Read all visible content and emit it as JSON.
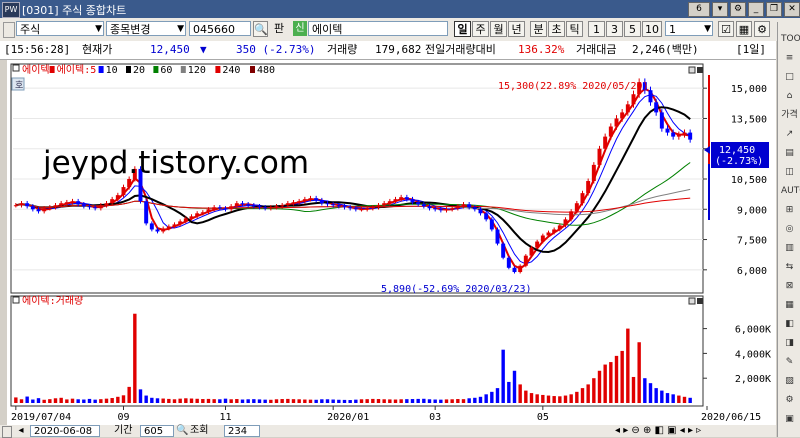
{
  "window": {
    "title": "[0301] 주식 종합차트",
    "logo": "PW",
    "page_num": "6"
  },
  "toolbar": {
    "market": "주식",
    "change_btn": "종목변경",
    "code": "045660",
    "pan_label": "판",
    "sin_label": "신",
    "name": "에이텍",
    "periods": [
      "일",
      "주",
      "월",
      "년",
      "분",
      "초",
      "틱"
    ],
    "intervals": [
      "1",
      "3",
      "5",
      "10"
    ],
    "interval_value": "1"
  },
  "infobar": {
    "time": "[15:56:28]",
    "price_label": "현재가",
    "price": "12,450",
    "arrow": "▼",
    "change": "350 (-2.73%)",
    "volume_label": "거래량",
    "volume": "179,682",
    "prev_ratio_label": "전일거래량대비",
    "prev_ratio": "136.32%",
    "amount_label": "거래대금",
    "amount": "2,246(백만)",
    "period_tag": "[1일]"
  },
  "price_legend": {
    "items": [
      {
        "label": "에이텍",
        "color": "#e00000"
      },
      {
        "label": "에이텍:5",
        "color": "#e00000"
      },
      {
        "label": "10",
        "color": "#0000ff"
      },
      {
        "label": "20",
        "color": "#000000"
      },
      {
        "label": "60",
        "color": "#008000"
      },
      {
        "label": "120",
        "color": "#808080"
      },
      {
        "label": "240",
        "color": "#e00000"
      },
      {
        "label": "480",
        "color": "#800000"
      }
    ]
  },
  "volume_legend": {
    "label": "에이텍:거래량"
  },
  "watermark": "jeypd.tistory.com",
  "annotations": {
    "high": "15,300(22.89% 2020/05/20)",
    "low": "5,890(-52.69% 2020/03/23)",
    "last_price": "12,450",
    "last_change": "(-2.73%)"
  },
  "chart_data": {
    "type": "candlestick",
    "price_axis": {
      "ticks": [
        "15,000",
        "13,500",
        "12,000",
        "10,500",
        "9,000",
        "7,500",
        "6,000"
      ],
      "ylim": [
        5000,
        16000
      ]
    },
    "volume_axis": {
      "ticks": [
        "6,000K",
        "4,000K",
        "2,000K"
      ],
      "ylim": [
        0,
        7500
      ]
    },
    "x_ticks": [
      "2019/07/04",
      "09",
      "11",
      "2020/01",
      "03",
      "05",
      "2020/06/15"
    ],
    "close_series": [
      9200,
      9300,
      9150,
      9000,
      8900,
      9050,
      9100,
      9200,
      9300,
      9350,
      9400,
      9250,
      9150,
      9100,
      9050,
      9200,
      9300,
      9500,
      9700,
      10100,
      10500,
      11000,
      9400,
      8300,
      8000,
      7900,
      8050,
      8150,
      8250,
      8400,
      8550,
      8650,
      8800,
      8850,
      9000,
      9100,
      9050,
      9000,
      9150,
      9300,
      9250,
      9200,
      9150,
      9100,
      9050,
      9100,
      9150,
      9200,
      9300,
      9350,
      9400,
      9500,
      9550,
      9450,
      9300,
      9250,
      9200,
      9150,
      9100,
      9050,
      9000,
      9000,
      9050,
      9100,
      9200,
      9300,
      9400,
      9500,
      9600,
      9500,
      9350,
      9250,
      9150,
      9050,
      9000,
      8950,
      9000,
      9050,
      9150,
      9250,
      9100,
      9000,
      8800,
      8500,
      8000,
      7300,
      6600,
      6100,
      5890,
      6200,
      6700,
      7100,
      7400,
      7700,
      7850,
      8000,
      8200,
      8500,
      8900,
      9300,
      9800,
      10400,
      11200,
      12000,
      12600,
      13100,
      13500,
      13800,
      14200,
      14700,
      15300,
      14900,
      14300,
      13800,
      13000,
      12800,
      12600,
      12700,
      12800,
      12450
    ],
    "volume_series": [
      450,
      300,
      520,
      280,
      390,
      260,
      310,
      380,
      420,
      290,
      350,
      300,
      280,
      330,
      270,
      310,
      350,
      400,
      500,
      620,
      1300,
      7200,
      1100,
      600,
      420,
      380,
      360,
      330,
      300,
      350,
      380,
      360,
      340,
      320,
      330,
      310,
      300,
      350,
      300,
      320,
      280,
      300,
      310,
      290,
      270,
      260,
      300,
      320,
      330,
      310,
      300,
      280,
      270,
      260,
      300,
      300,
      280,
      260,
      250,
      240,
      270,
      300,
      310,
      330,
      320,
      300,
      290,
      280,
      300,
      310,
      320,
      330,
      340,
      300,
      280,
      270,
      290,
      300,
      320,
      310,
      380,
      420,
      500,
      700,
      900,
      1200,
      4300,
      1700,
      2600,
      1500,
      1000,
      800,
      700,
      650,
      600,
      560,
      540,
      600,
      700,
      900,
      1200,
      1500,
      2000,
      2600,
      3100,
      3300,
      3800,
      4200,
      6000,
      2100,
      4900,
      2000,
      1600,
      1200,
      1000,
      800,
      700,
      600,
      500,
      420
    ],
    "ma_colors": {
      "ma5": "#e00000",
      "ma10": "#0000ff",
      "ma20": "#000000",
      "ma60": "#008000",
      "ma120": "#808080",
      "ma240": "#e00000",
      "ma480": "#800000"
    },
    "up_color": "#e00000",
    "down_color": "#0000ff"
  },
  "sidebar": {
    "items": [
      "TOOL",
      "≡",
      "□",
      "⌂",
      "가격",
      "↗",
      "▤",
      "◫",
      "AUTO",
      "⊞",
      "◎",
      "▥",
      "⇆",
      "⊠",
      "▦",
      "◧",
      "◨",
      "✎",
      "▨",
      "⚙",
      "▣"
    ]
  },
  "bottombar": {
    "date": "2020-06-08",
    "period_label": "기간",
    "period_value": "605",
    "view_label": "조회",
    "view_value": "234"
  }
}
